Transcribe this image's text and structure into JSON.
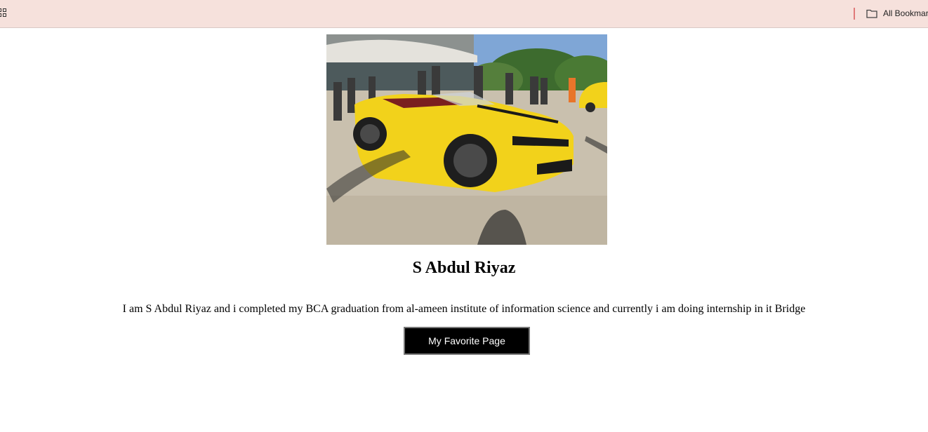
{
  "bookmarks_bar": {
    "apps_icon": "apps-grid-icon",
    "folder_icon": "folder-icon",
    "all_bookmarks_label": "All Bookmar"
  },
  "profile": {
    "photo_alt": "yellow-convertible-car-photo",
    "name": "S Abdul Riyaz",
    "bio": "I am S Abdul Riyaz and i completed my BCA graduation from al-ameen institute of information science and currently i am doing internship in it Bridge",
    "button_label": "My Favorite Page"
  },
  "colors": {
    "bookmarks_bar_bg": "#f6e1dc",
    "button_bg": "#000000",
    "button_text": "#ffffff",
    "car_yellow": "#f2d21b"
  }
}
